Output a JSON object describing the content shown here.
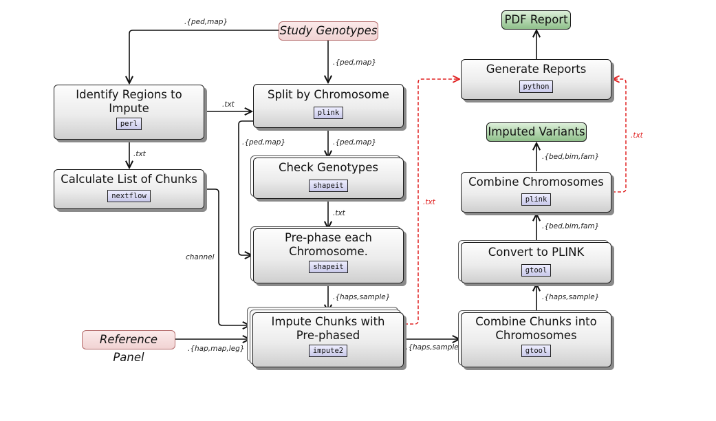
{
  "diagram": {
    "inputs": {
      "study_genotypes": "Study Genotypes",
      "reference_panel": "Reference Panel"
    },
    "outputs": {
      "pdf_report": "PDF Report",
      "imputed_variants": "Imputed Variants"
    },
    "processes": {
      "identify_regions": {
        "title": "Identify Regions to Impute",
        "tool": "perl"
      },
      "calculate_chunks": {
        "title": "Calculate List of Chunks",
        "tool": "nextflow"
      },
      "split_chromosome": {
        "title": "Split by Chromosome",
        "tool": "plink"
      },
      "check_genotypes": {
        "title": "Check Genotypes",
        "tool": "shapeit"
      },
      "prephase": {
        "title": "Pre-phase each Chromosome.",
        "tool": "shapeit"
      },
      "impute_chunks": {
        "title": "Impute Chunks with Pre-phased",
        "tool": "impute2"
      },
      "generate_reports": {
        "title": "Generate Reports",
        "tool": "python"
      },
      "combine_chromosomes": {
        "title": "Combine Chromosomes",
        "tool": "plink"
      },
      "convert_plink": {
        "title": "Convert to PLINK",
        "tool": "gtool"
      },
      "combine_chunks": {
        "title": "Combine Chunks into Chromosomes",
        "tool": "gtool"
      }
    },
    "edge_labels": {
      "study_to_identify": ".{ped,map}",
      "study_to_split": ".{ped,map}",
      "identify_to_split": ".txt",
      "identify_to_calculate": ".txt",
      "split_to_prephase": ".{ped,map}",
      "split_to_check": ".{ped,map}",
      "check_to_prephase": ".txt",
      "prephase_to_impute": ".{haps,sample}",
      "calculate_to_impute": "channel",
      "reference_to_impute": ".{hap,map,leg}",
      "impute_to_combine_chunks": ".{haps,sample}",
      "combine_chunks_to_convert": ".{haps,sample}",
      "convert_to_combine_chr": ".{bed,bim,fam}",
      "combine_chr_to_variants": ".{bed,bim,fam}",
      "impute_to_reports": ".txt",
      "combine_chr_to_reports": ".txt"
    },
    "colors": {
      "edge": "#111111",
      "report_edge": "#e02020",
      "input_fill": "#f4dcdc",
      "input_border": "#b46a6a",
      "output_fill": "#a8d0a3",
      "tool_fill": "#d6d6f0"
    }
  }
}
